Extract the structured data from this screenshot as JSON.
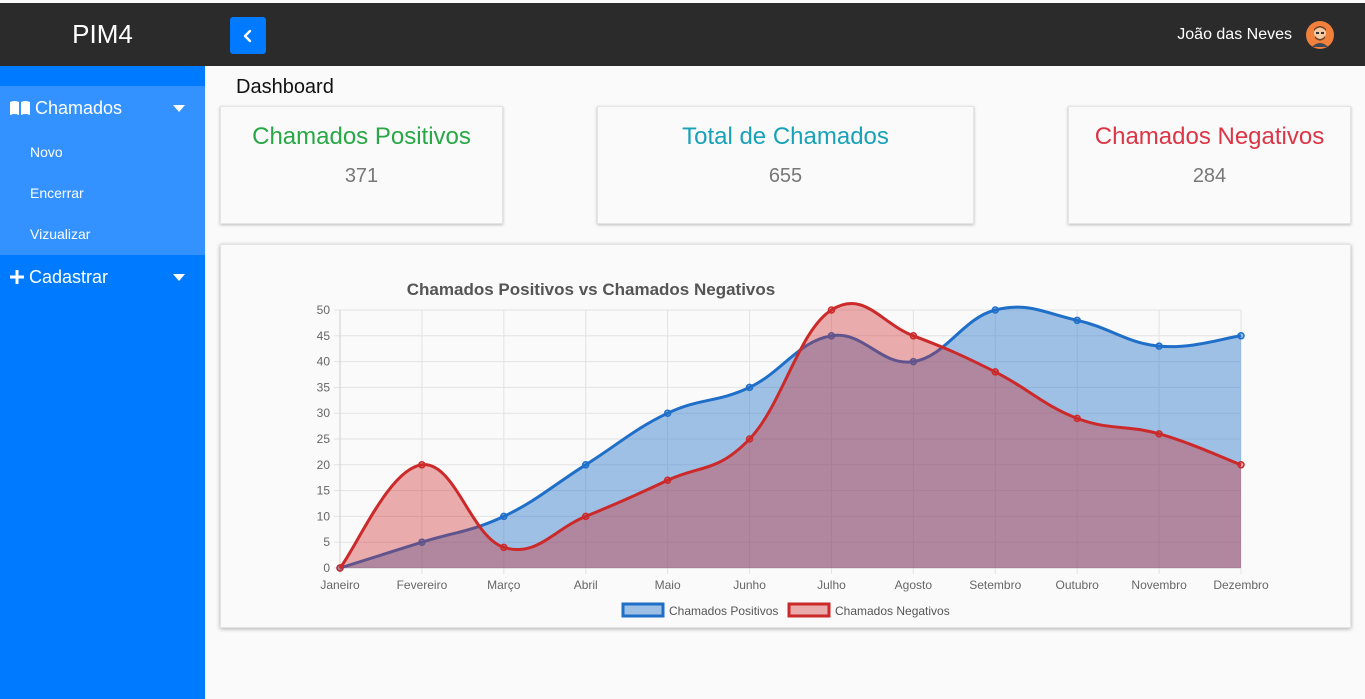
{
  "header": {
    "brand": "PIM4",
    "user_name": "João das Neves",
    "toggle_icon": "chevron-left-icon",
    "avatar_icon": "user-avatar-icon"
  },
  "sidebar": {
    "chamados": {
      "label": "Chamados",
      "icon": "book-icon",
      "items": [
        {
          "label": "Novo"
        },
        {
          "label": "Encerrar"
        },
        {
          "label": "Vizualizar"
        }
      ]
    },
    "cadastrar": {
      "label": "Cadastrar",
      "icon": "plus-icon"
    }
  },
  "page": {
    "title": "Dashboard"
  },
  "cards": [
    {
      "title": "Chamados Positivos",
      "value": "371",
      "color": "#28a745"
    },
    {
      "title": "Total de Chamados",
      "value": "655",
      "color": "#17a2b8"
    },
    {
      "title": "Chamados Negativos",
      "value": "284",
      "color": "#dc3545"
    }
  ],
  "colors": {
    "accent": "#007bff",
    "topbar": "#2b2b2b",
    "positive_line": "#1f6fc9",
    "negative_line": "#cc2a2a"
  },
  "chart_data": {
    "type": "area",
    "title": "Chamados Positivos vs Chamados Negativos",
    "categories": [
      "Janeiro",
      "Fevereiro",
      "Março",
      "Abril",
      "Maio",
      "Junho",
      "Julho",
      "Agosto",
      "Setembro",
      "Outubro",
      "Novembro",
      "Dezembro"
    ],
    "series": [
      {
        "name": "Chamados Positivos",
        "values": [
          0,
          5,
          10,
          20,
          30,
          35,
          45,
          40,
          50,
          48,
          43,
          45
        ],
        "color": "#1f6fc9"
      },
      {
        "name": "Chamados Negativos",
        "values": [
          0,
          20,
          4,
          10,
          17,
          25,
          50,
          45,
          38,
          29,
          26,
          20
        ],
        "color": "#cc2a2a"
      }
    ],
    "ylim": [
      0,
      50
    ],
    "yticks": [
      0,
      5,
      10,
      15,
      20,
      25,
      30,
      35,
      40,
      45,
      50
    ],
    "grid": true,
    "legend": "bottom"
  }
}
